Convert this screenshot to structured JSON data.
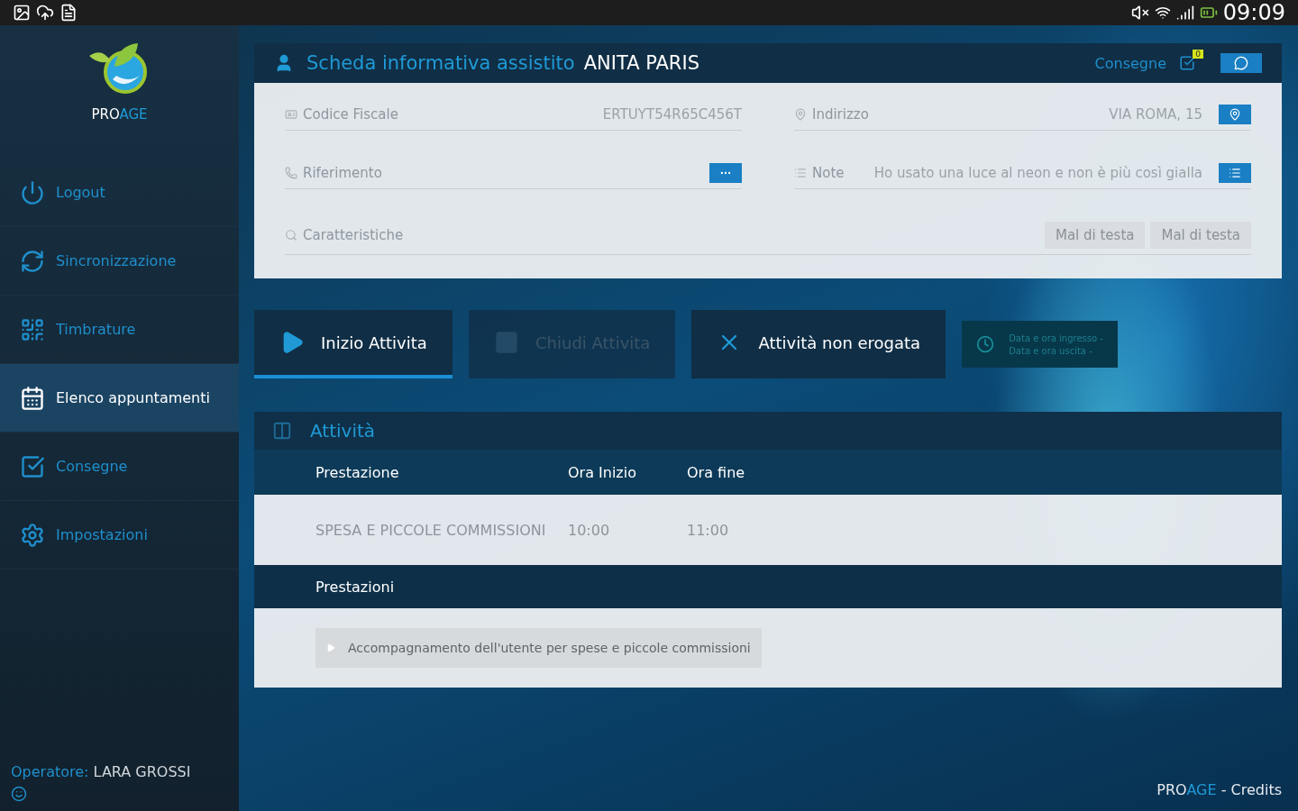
{
  "status_bar": {
    "time": "09:09"
  },
  "sidebar": {
    "logo": {
      "primary": "PRO",
      "accent": "AGE"
    },
    "items": [
      {
        "label": "Logout",
        "selected": false
      },
      {
        "label": "Sincronizzazione",
        "selected": false
      },
      {
        "label": "Timbrature",
        "selected": false
      },
      {
        "label": "Elenco appuntamenti",
        "selected": true
      },
      {
        "label": "Consegne",
        "selected": false
      },
      {
        "label": "Impostazioni",
        "selected": false
      }
    ],
    "operator": {
      "label": "Operatore:",
      "name": "LARA GROSSI"
    }
  },
  "header": {
    "title": "Scheda informativa assistito",
    "patient": "ANITA  PARIS",
    "link": "Consegne",
    "badge": "0"
  },
  "fields": [
    {
      "label": "Codice Fiscale",
      "value": "ERTUYT54R65C456T"
    },
    {
      "label": "Indirizzo",
      "value": "VIA ROMA, 15"
    },
    {
      "label": "Riferimento"
    },
    {
      "label": "Note",
      "value": "Ho usato una luce al neon e non è più così gialla"
    }
  ],
  "characteristics": {
    "label": "Caratteristiche",
    "tags": [
      "Mal di testa",
      "Mal di testa"
    ]
  },
  "actions": [
    {
      "label": "Inizio Attivita",
      "active": true,
      "disabled": false
    },
    {
      "label": "Chiudi Attivita",
      "active": false,
      "disabled": true
    },
    {
      "label": "Attività non erogata",
      "active": false,
      "disabled": false
    }
  ],
  "times": [
    "Data e ora ingresso -",
    "Data e ora uscita -"
  ],
  "activity": {
    "title": "Attività",
    "columns": [
      "Prestazione",
      "Ora Inizio",
      "Ora fine"
    ],
    "rows": [
      [
        "SPESA E PICCOLE COMMISSIONI",
        "10:00",
        "11:00"
      ]
    ],
    "services_title": "Prestazioni",
    "services": [
      "Accompagnamento dell'utente per spese e piccole commissioni"
    ]
  },
  "footer": {
    "primary": "PRO",
    "accent": "AGE",
    "credits": "- Credits"
  }
}
